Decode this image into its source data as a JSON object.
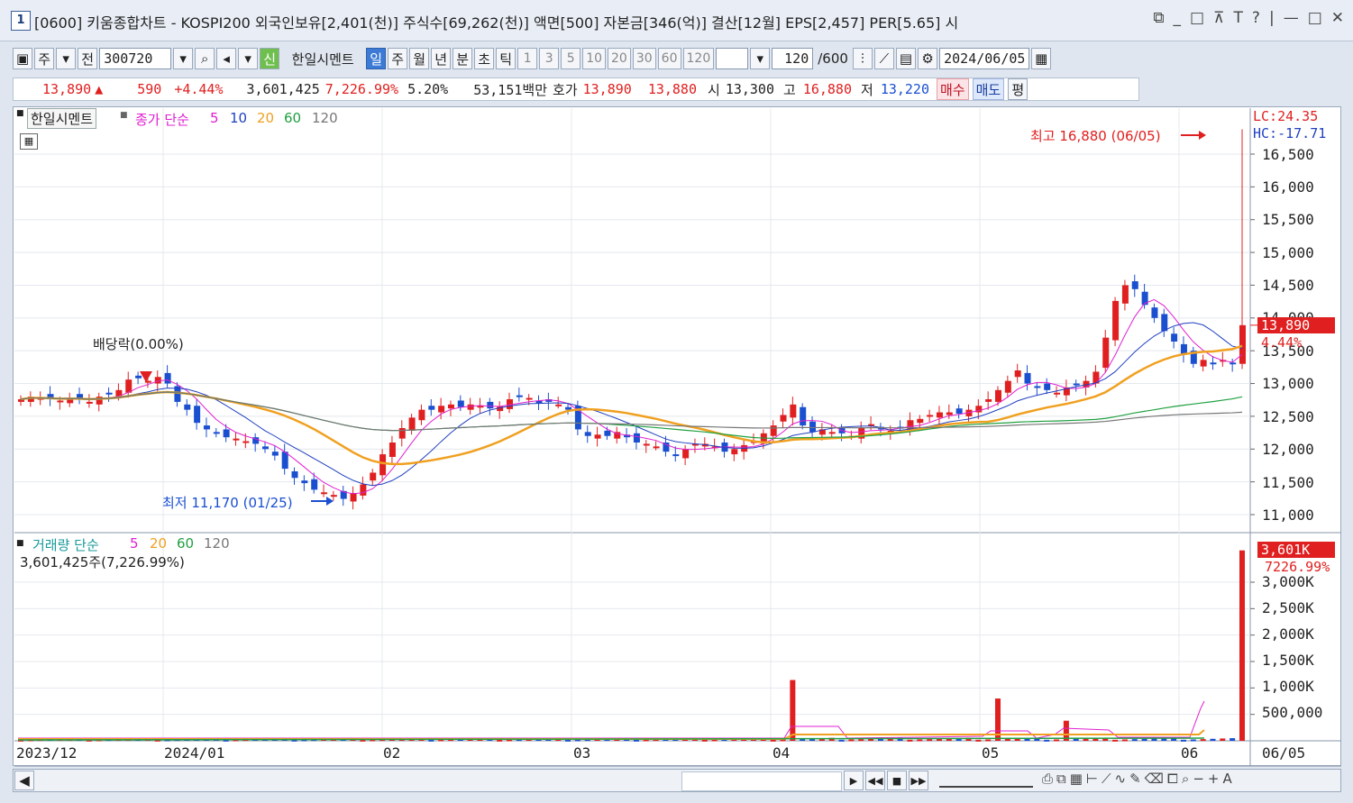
{
  "titlebar": {
    "window_num": "1",
    "title": "[0600] 키움종합차트 - KOSPI200 외국인보유[2,401(천)] 주식수[69,262(천)] 액면[500] 자본금[346(억)] 결산[12월] EPS[2,457] PER[5.65] 시",
    "buttons": [
      "⧉",
      "_",
      "□",
      "⊼",
      "T",
      "?",
      "|",
      "—",
      "□",
      "✕"
    ]
  },
  "toolbar": {
    "type1": "주",
    "type2": "전",
    "code": "300720",
    "new_badge": "신",
    "stock_name": "한일시멘트",
    "periods": [
      "일",
      "주",
      "월",
      "년",
      "분",
      "초",
      "틱"
    ],
    "selected_period": "일",
    "intervals": [
      "1",
      "3",
      "5",
      "10",
      "20",
      "30",
      "60",
      "120"
    ],
    "count": "120",
    "count_total": "/600",
    "date": "2024/06/05"
  },
  "info": {
    "price": "13,890",
    "change": "590",
    "change_pct": "+4.44%",
    "volume": "3,601,425",
    "volume_pct": "7,226.99%",
    "turnover": "5.20%",
    "amount": "53,151백만",
    "bid_label": "호가",
    "ask": "13,890",
    "bid": "13,880",
    "open_label": "시",
    "open": "13,300",
    "high_label": "고",
    "high": "16,880",
    "low_label": "저",
    "low": "13,220",
    "buy": "매수",
    "sell": "매도",
    "even": "평"
  },
  "price_panel": {
    "name": "한일시멘트",
    "legend": [
      "종가 단순",
      "5",
      "10",
      "20",
      "60",
      "120"
    ],
    "lc": "LC:24.35",
    "hc": "HC:-17.71",
    "max_label": "최고 16,880 (06/05)",
    "min_label": "최저 11,170 (01/25)",
    "dividend_label": "배당락(0.00%)",
    "current_price_tag": "13,890",
    "current_pct_tag": "4.44%",
    "yticks": [
      "16,500",
      "16,000",
      "15,500",
      "15,000",
      "14,500",
      "14,000",
      "13,500",
      "13,000",
      "12,500",
      "12,000",
      "11,500",
      "11,000"
    ]
  },
  "volume_panel": {
    "legend": [
      "거래량 단순",
      "5",
      "20",
      "60",
      "120"
    ],
    "value_line": "3,601,425주(7,226.99%)",
    "current_tag": "3,601K",
    "current_pct": "7226.99%",
    "yticks": [
      "3,000K",
      "2,500K",
      "2,000K",
      "1,500K",
      "1,000K",
      "500,000"
    ]
  },
  "xaxis": [
    "2023/12",
    "2024/01",
    "02",
    "03",
    "04",
    "05",
    "06",
    "06/05"
  ],
  "colors": {
    "up": "#e02020",
    "down": "#1a4fd0",
    "ma5": "#e020d0",
    "ma10": "#2040c0",
    "ma20": "#f0a020",
    "ma60": "#20a040",
    "ma120": "#777777"
  }
}
